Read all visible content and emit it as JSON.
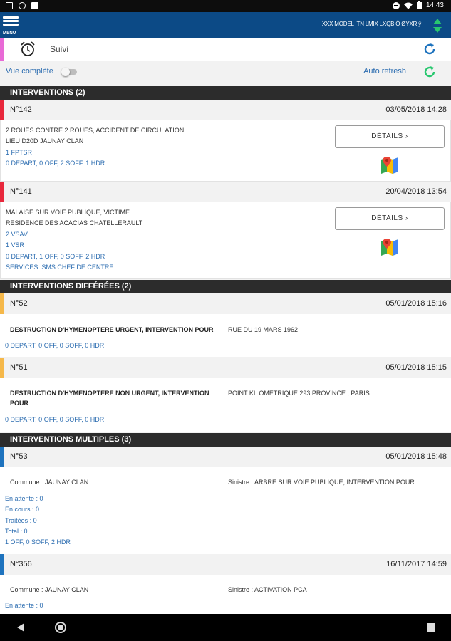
{
  "status": {
    "time": "14:43"
  },
  "appbar": {
    "menu_label": "MENU",
    "ticker": "XXX MODEL ITN LMIX LXQB Ô ØYXR ȳ"
  },
  "suivi": {
    "label": "Suivi"
  },
  "toggles": {
    "vue_complete": "Vue complète",
    "vue_complete_on": false,
    "auto_refresh": "Auto refresh"
  },
  "sections": {
    "interventions": "INTERVENTIONS (2)",
    "differees": "INTERVENTIONS DIFFÉRÉES (2)",
    "multiples": "INTERVENTIONS MULTIPLES (3)"
  },
  "details_label": "DÉTAILS",
  "interventions": [
    {
      "num": "N°142",
      "date": "03/05/2018 14:28",
      "color": "#e8283c",
      "lines": [
        "2 ROUES CONTRE 2 ROUES, ACCIDENT DE CIRCULATION",
        "LIEU D20D JAUNAY CLAN"
      ],
      "blue_lines": [
        "1 FPTSR",
        "0 DEPART, 0 OFF, 2 SOFF, 1 HDR"
      ]
    },
    {
      "num": "N°141",
      "date": "20/04/2018 13:54",
      "color": "#e8283c",
      "lines": [
        "MALAISE SUR VOIE PUBLIQUE, VICTIME",
        "RESIDENCE DES ACACIAS CHATELLERAULT"
      ],
      "blue_lines": [
        "2 VSAV",
        "1 VSR",
        "0 DEPART, 1 OFF, 0 SOFF, 2 HDR",
        "SERVICES: SMS CHEF DE CENTRE"
      ]
    }
  ],
  "differees": [
    {
      "num": "N°52",
      "date": "05/01/2018 15:16",
      "color": "#f5b84a",
      "title": "DESTRUCTION D'HYMENOPTERE URGENT, INTERVENTION POUR",
      "title2": "",
      "location": "RUE DU 19 MARS 1962",
      "summary": "0 DEPART, 0 OFF, 0 SOFF, 0 HDR"
    },
    {
      "num": "N°51",
      "date": "05/01/2018 15:15",
      "color": "#f5b84a",
      "title": "DESTRUCTION D'HYMENOPTERE NON URGENT, INTERVENTION",
      "title2": "POUR",
      "location": "POINT KILOMETRIQUE 293 PROVINCE , PARIS",
      "summary": "0 DEPART, 0 OFF, 0 SOFF, 0 HDR"
    }
  ],
  "multiples": [
    {
      "num": "N°53",
      "date": "05/01/2018 15:48",
      "color": "#1e73be",
      "commune": "Commune : JAUNAY CLAN",
      "sinistre": "Sinistre : ARBRE SUR VOIE PUBLIQUE, INTERVENTION POUR",
      "stats": [
        "En attente : 0",
        "En cours : 0",
        "Traitées : 0",
        "Total : 0",
        "1 OFF, 0 SOFF, 2 HDR"
      ]
    },
    {
      "num": "N°356",
      "date": "16/11/2017 14:59",
      "color": "#1e73be",
      "commune": "Commune : JAUNAY CLAN",
      "sinistre": "Sinistre : ACTIVATION PCA",
      "stats": [
        "En attente : 0"
      ]
    }
  ]
}
